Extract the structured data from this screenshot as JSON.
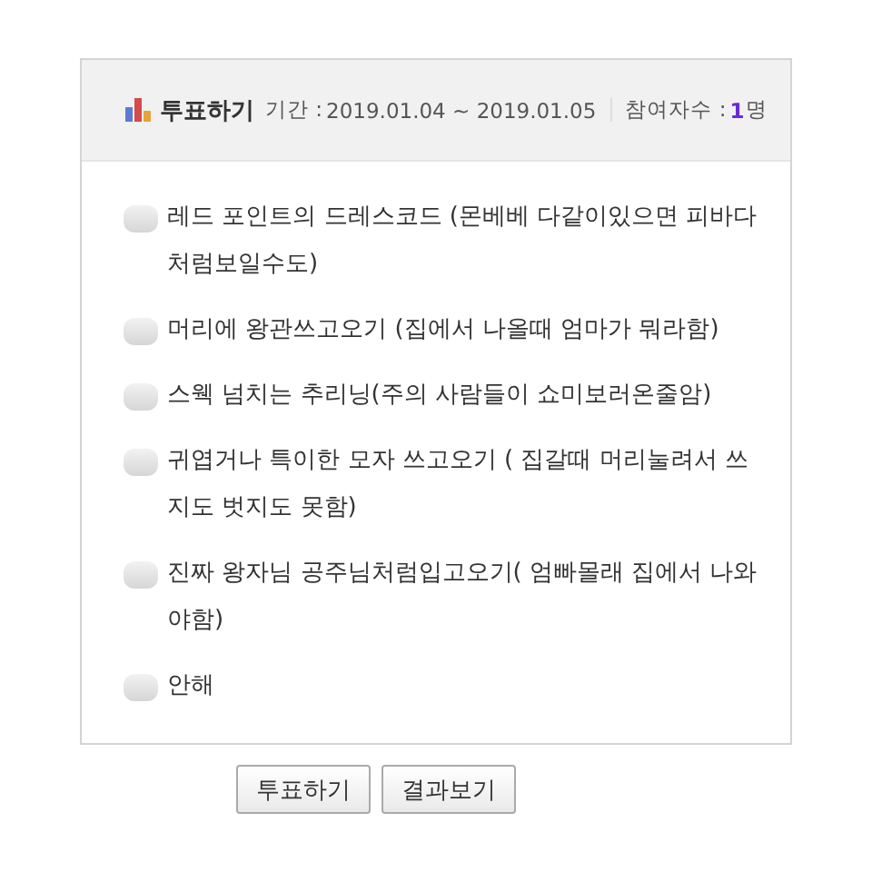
{
  "poll": {
    "title": "투표하기",
    "period_label": "기간 :",
    "period": "2019.01.04 ~ 2019.01.05",
    "participants_label": "참여자수 :",
    "participants": "1",
    "participants_unit": "명"
  },
  "options": [
    {
      "label": "레드 포인트의 드레스코드 (몬베베 다같이있으면 피바다 처럼보일수도)",
      "selected": false
    },
    {
      "label": "머리에 왕관쓰고오기 (집에서 나올때 엄마가 뭐라함)",
      "selected": false
    },
    {
      "label": "스웩 넘치는 추리닝(주의 사람들이 쇼미보러온줄암)",
      "selected": false
    },
    {
      "label": "귀엽거나 특이한 모자 쓰고오기 ( 집갈때 머리눌려서 쓰지도 벗지도 못함)",
      "selected": false
    },
    {
      "label": "진짜 왕자님 공주님처럼입고오기( 엄빠몰래 집에서 나와야함)",
      "selected": false
    },
    {
      "label": "안해",
      "selected": false
    }
  ],
  "buttons": [
    "투표하기",
    "결과보기"
  ]
}
